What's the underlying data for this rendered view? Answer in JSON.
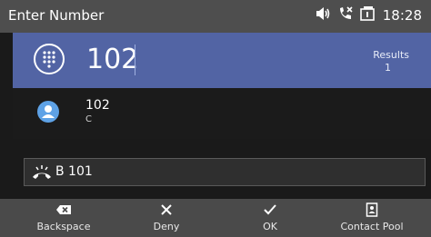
{
  "status_bar": {
    "title": "Enter Number",
    "time": "18:28",
    "icons": [
      "speaker-volume-icon",
      "missed-call-icon",
      "voicemail-icon"
    ]
  },
  "input": {
    "value": "102",
    "results_label": "Results",
    "results_count": "1"
  },
  "result": {
    "name": "102",
    "detail": "C"
  },
  "active_call": {
    "label": "B 101"
  },
  "softkeys": [
    {
      "label": "Backspace",
      "icon": "backspace-icon"
    },
    {
      "label": "Deny",
      "icon": "close-icon"
    },
    {
      "label": "OK",
      "icon": "check-icon"
    },
    {
      "label": "Contact Pool",
      "icon": "contacts-book-icon"
    }
  ],
  "colors": {
    "status_bar_bg": "#4e4e4e",
    "input_bg": "#5264a4",
    "avatar": "#5ea2e6",
    "softkey_bg": "#4a4a4a"
  }
}
